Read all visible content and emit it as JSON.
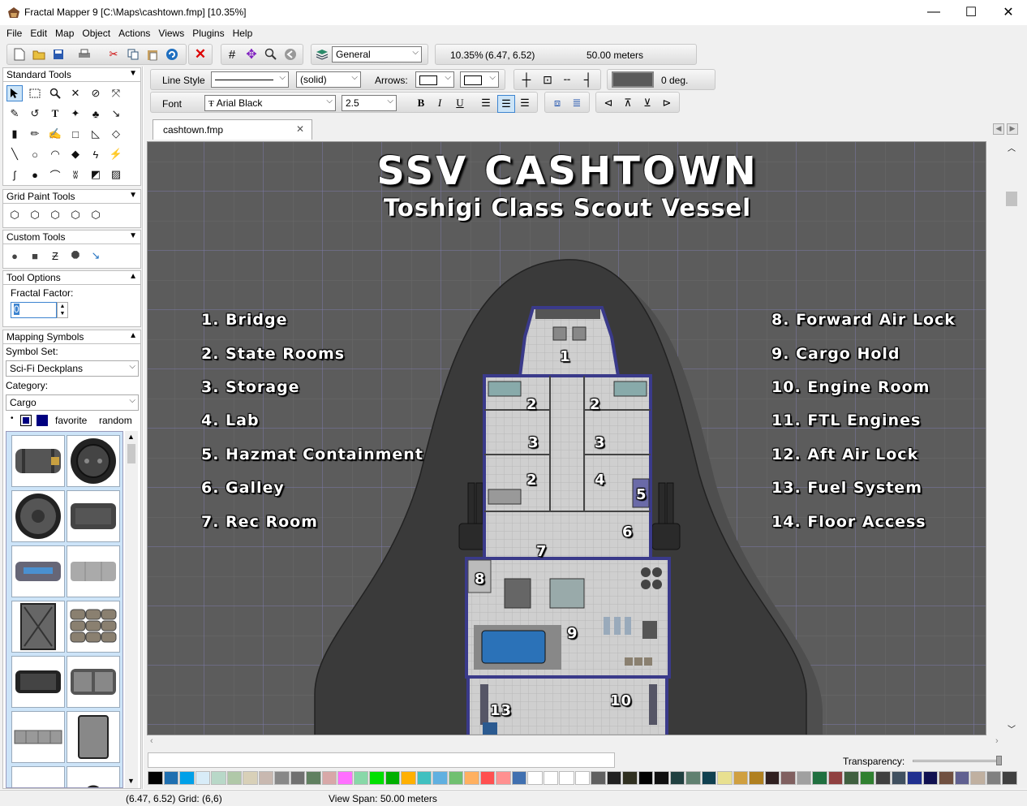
{
  "window": {
    "title": "Fractal Mapper 9 [C:\\Maps\\cashtown.fmp] [10.35%]",
    "minimize": "—",
    "maximize": "☐",
    "close": "✕"
  },
  "menu": [
    "File",
    "Edit",
    "Map",
    "Object",
    "Actions",
    "Views",
    "Plugins",
    "Help"
  ],
  "toolbar": {
    "layer": "General",
    "zoom": "10.35%",
    "coords": "(6.47, 6.52)",
    "scale": "50.00 meters"
  },
  "props": {
    "line_style_label": "Line Style",
    "line_pattern": "(solid)",
    "arrows_label": "Arrows:",
    "angle": "0 deg.",
    "font_label": "Font",
    "font_value": "Arial Black",
    "font_size": "2.5",
    "bold": "B",
    "italic": "I",
    "underline": "U"
  },
  "left": {
    "standard_tools": "Standard Tools",
    "grid_paint_tools": "Grid Paint Tools",
    "custom_tools": "Custom Tools",
    "tool_options": "Tool Options",
    "fractal_factor_label": "Fractal Factor:",
    "fractal_factor_value": "0",
    "mapping_symbols": "Mapping Symbols",
    "symbol_set_label": "Symbol Set:",
    "symbol_set_value": "Sci-Fi Deckplans",
    "category_label": "Category:",
    "category_value": "Cargo",
    "favorite": "favorite",
    "random": "random"
  },
  "tab": {
    "label": "cashtown.fmp",
    "close": "✕"
  },
  "map": {
    "title": "SSV CASHTOWN",
    "subtitle": "Toshigi Class Scout Vessel",
    "legend_left": [
      "1. Bridge",
      "2. State Rooms",
      "3. Storage",
      "4. Lab",
      "5. Hazmat Containment",
      "6. Galley",
      "7. Rec Room"
    ],
    "legend_right": [
      "8. Forward Air Lock",
      "9. Cargo Hold",
      "10. Engine Room",
      "11. FTL Engines",
      "12. Aft Air Lock",
      "13. Fuel System",
      "14. Floor Access"
    ],
    "room_numbers": [
      "1",
      "2",
      "2",
      "3",
      "3",
      "2",
      "4",
      "5",
      "6",
      "7",
      "8",
      "9",
      "10",
      "13"
    ]
  },
  "transparency_label": "Transparency:",
  "palette_colors": [
    "#000000",
    "#1f6fb0",
    "#00a0e8",
    "#d8ecf8",
    "#b8d8c8",
    "#b0c8a8",
    "#d8d0b8",
    "#c8b8b0",
    "#888888",
    "#707070",
    "#608060",
    "#d8a8a8",
    "#ff70ff",
    "#88d8a8",
    "#00e000",
    "#00b000",
    "#ffb000",
    "#40c0c0",
    "#60b0e0",
    "#70c070",
    "#ffb060",
    "#ff5050",
    "#ff9090",
    "#4070b0",
    "#ffffff",
    "#ffffff",
    "#ffffff",
    "#ffffff",
    "#606060",
    "#202020",
    "#303020",
    "#000000",
    "#101010",
    "#204040",
    "#608070",
    "#104050",
    "#e8e090",
    "#d0a040",
    "#b08020",
    "#302020",
    "#806060",
    "#a0a0a0",
    "#207040",
    "#904040",
    "#406040",
    "#308030",
    "#404040",
    "#405060",
    "#203090",
    "#101050",
    "#705040",
    "#606090",
    "#c0b0a0",
    "#808080",
    "#404040"
  ],
  "status": {
    "coords": "(6.47, 6.52) Grid: (6,6)",
    "view_span": "View Span: 50.00 meters"
  }
}
